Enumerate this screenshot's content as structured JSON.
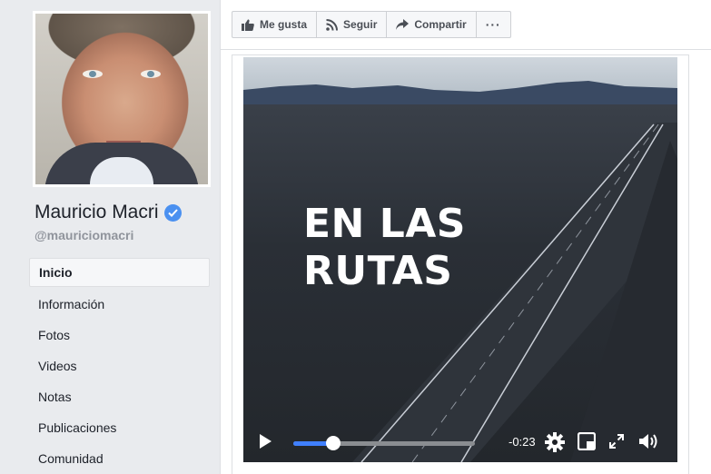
{
  "sidebar": {
    "page_name": "Mauricio Macri",
    "handle": "@mauriciomacri",
    "nav": [
      {
        "label": "Inicio",
        "active": true
      },
      {
        "label": "Información",
        "active": false
      },
      {
        "label": "Fotos",
        "active": false
      },
      {
        "label": "Videos",
        "active": false
      },
      {
        "label": "Notas",
        "active": false
      },
      {
        "label": "Publicaciones",
        "active": false
      },
      {
        "label": "Comunidad",
        "active": false
      }
    ]
  },
  "actionbar": {
    "like_label": "Me gusta",
    "follow_label": "Seguir",
    "share_label": "Compartir",
    "more_label": "···"
  },
  "video": {
    "title_line1": "EN LAS",
    "title_line2": "RUTAS",
    "time_remaining": "-0:23",
    "progress": 0.22,
    "icons": [
      "play-icon",
      "settings-icon",
      "pip-icon",
      "fullscreen-icon",
      "volume-icon"
    ]
  },
  "colors": {
    "accent": "#4080ff",
    "verified": "#4a90f0",
    "background": "#e9ebee"
  }
}
